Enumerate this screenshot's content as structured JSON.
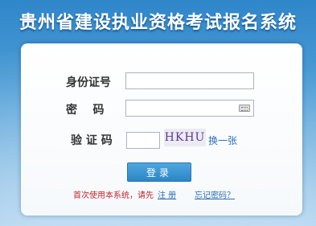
{
  "header": {
    "title": "贵州省建设执业资格考试报名系统"
  },
  "form": {
    "id_label": "身份证号",
    "id_value": "",
    "password_label": "密    码",
    "password_value": "",
    "password_keyboard_icon": "keyboard-icon",
    "captcha_label": "验 证 码",
    "captcha_value": "",
    "captcha_image_text": "HKHU",
    "refresh_label": "换一张",
    "login_label": "登录"
  },
  "footer": {
    "notice": "首次使用本系统，请先",
    "register_label": "注 册",
    "forgot_label": "忘记密码？"
  },
  "colors": {
    "accent": "#2b86c8",
    "notice": "#c0282d",
    "link": "#2d6fb5"
  }
}
